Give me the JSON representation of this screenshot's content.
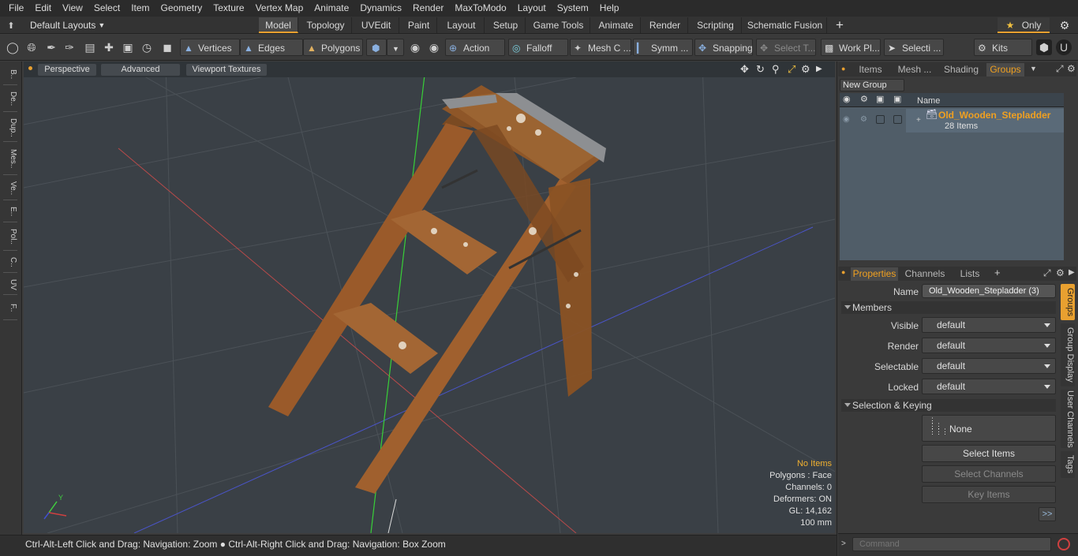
{
  "menus": [
    "File",
    "Edit",
    "View",
    "Select",
    "Item",
    "Geometry",
    "Texture",
    "Vertex Map",
    "Animate",
    "Dynamics",
    "Render",
    "MaxToModo",
    "Layout",
    "System",
    "Help"
  ],
  "layouts_label": "Default Layouts",
  "tabs": [
    "Model",
    "Topology",
    "UVEdit",
    "Paint",
    "Layout",
    "Setup",
    "Game Tools",
    "Animate",
    "Render",
    "Scripting",
    "Schematic Fusion"
  ],
  "only_label": "Only",
  "toolbar": {
    "vertices": "Vertices",
    "edges": "Edges",
    "polygons": "Polygons",
    "action": "Action",
    "falloff": "Falloff",
    "mesh": "Mesh C ...",
    "symm": "Symm ...",
    "snapping": "Snapping",
    "select_t": "Select T...",
    "work_pl": "Work Pl...",
    "selecti": "Selecti ...",
    "kits": "Kits"
  },
  "left_tabs": [
    "B..",
    "De..",
    "Dup..",
    "Mes..",
    "Ve..",
    "E..",
    "Pol..",
    "C..",
    "UV",
    "F.."
  ],
  "viewport": {
    "perspective": "Perspective",
    "advanced": "Advanced",
    "textures": "Viewport Textures",
    "info": [
      "No Items",
      "Polygons : Face",
      "Channels: 0",
      "Deformers: ON",
      "GL: 14,162",
      "100 mm"
    ],
    "axis_y": "Y"
  },
  "status": "Ctrl-Alt-Left Click and Drag: Navigation: Zoom ● Ctrl-Alt-Right Click and Drag: Navigation: Box Zoom",
  "groups_panel": {
    "tabs": [
      "Items",
      "Mesh ...",
      "Shading",
      "Groups"
    ],
    "new_group": "New Group",
    "col_name": "Name",
    "group_name": "Old_Wooden_Stepladder",
    "group_count": "28 Items"
  },
  "properties_panel": {
    "tabs": [
      "Properties",
      "Channels",
      "Lists"
    ],
    "name_label": "Name",
    "name_value": "Old_Wooden_Stepladder (3)",
    "members": "Members",
    "visible_label": "Visible",
    "render_label": "Render",
    "selectable_label": "Selectable",
    "locked_label": "Locked",
    "default_value": "default",
    "selection_keying": "Selection & Keying",
    "none": "None",
    "select_items": "Select Items",
    "select_channels": "Select Channels",
    "key_items": "Key Items",
    "more": ">>",
    "side_tabs": [
      "Groups",
      "Group Display",
      "User Channels",
      "Tags"
    ]
  },
  "command_placeholder": "Command",
  "colors": {
    "accent": "#e8a030",
    "viewport_bg": "#3a4046",
    "x_axis": "#c04040",
    "y_axis": "#40d040",
    "z_axis": "#4050d0"
  }
}
